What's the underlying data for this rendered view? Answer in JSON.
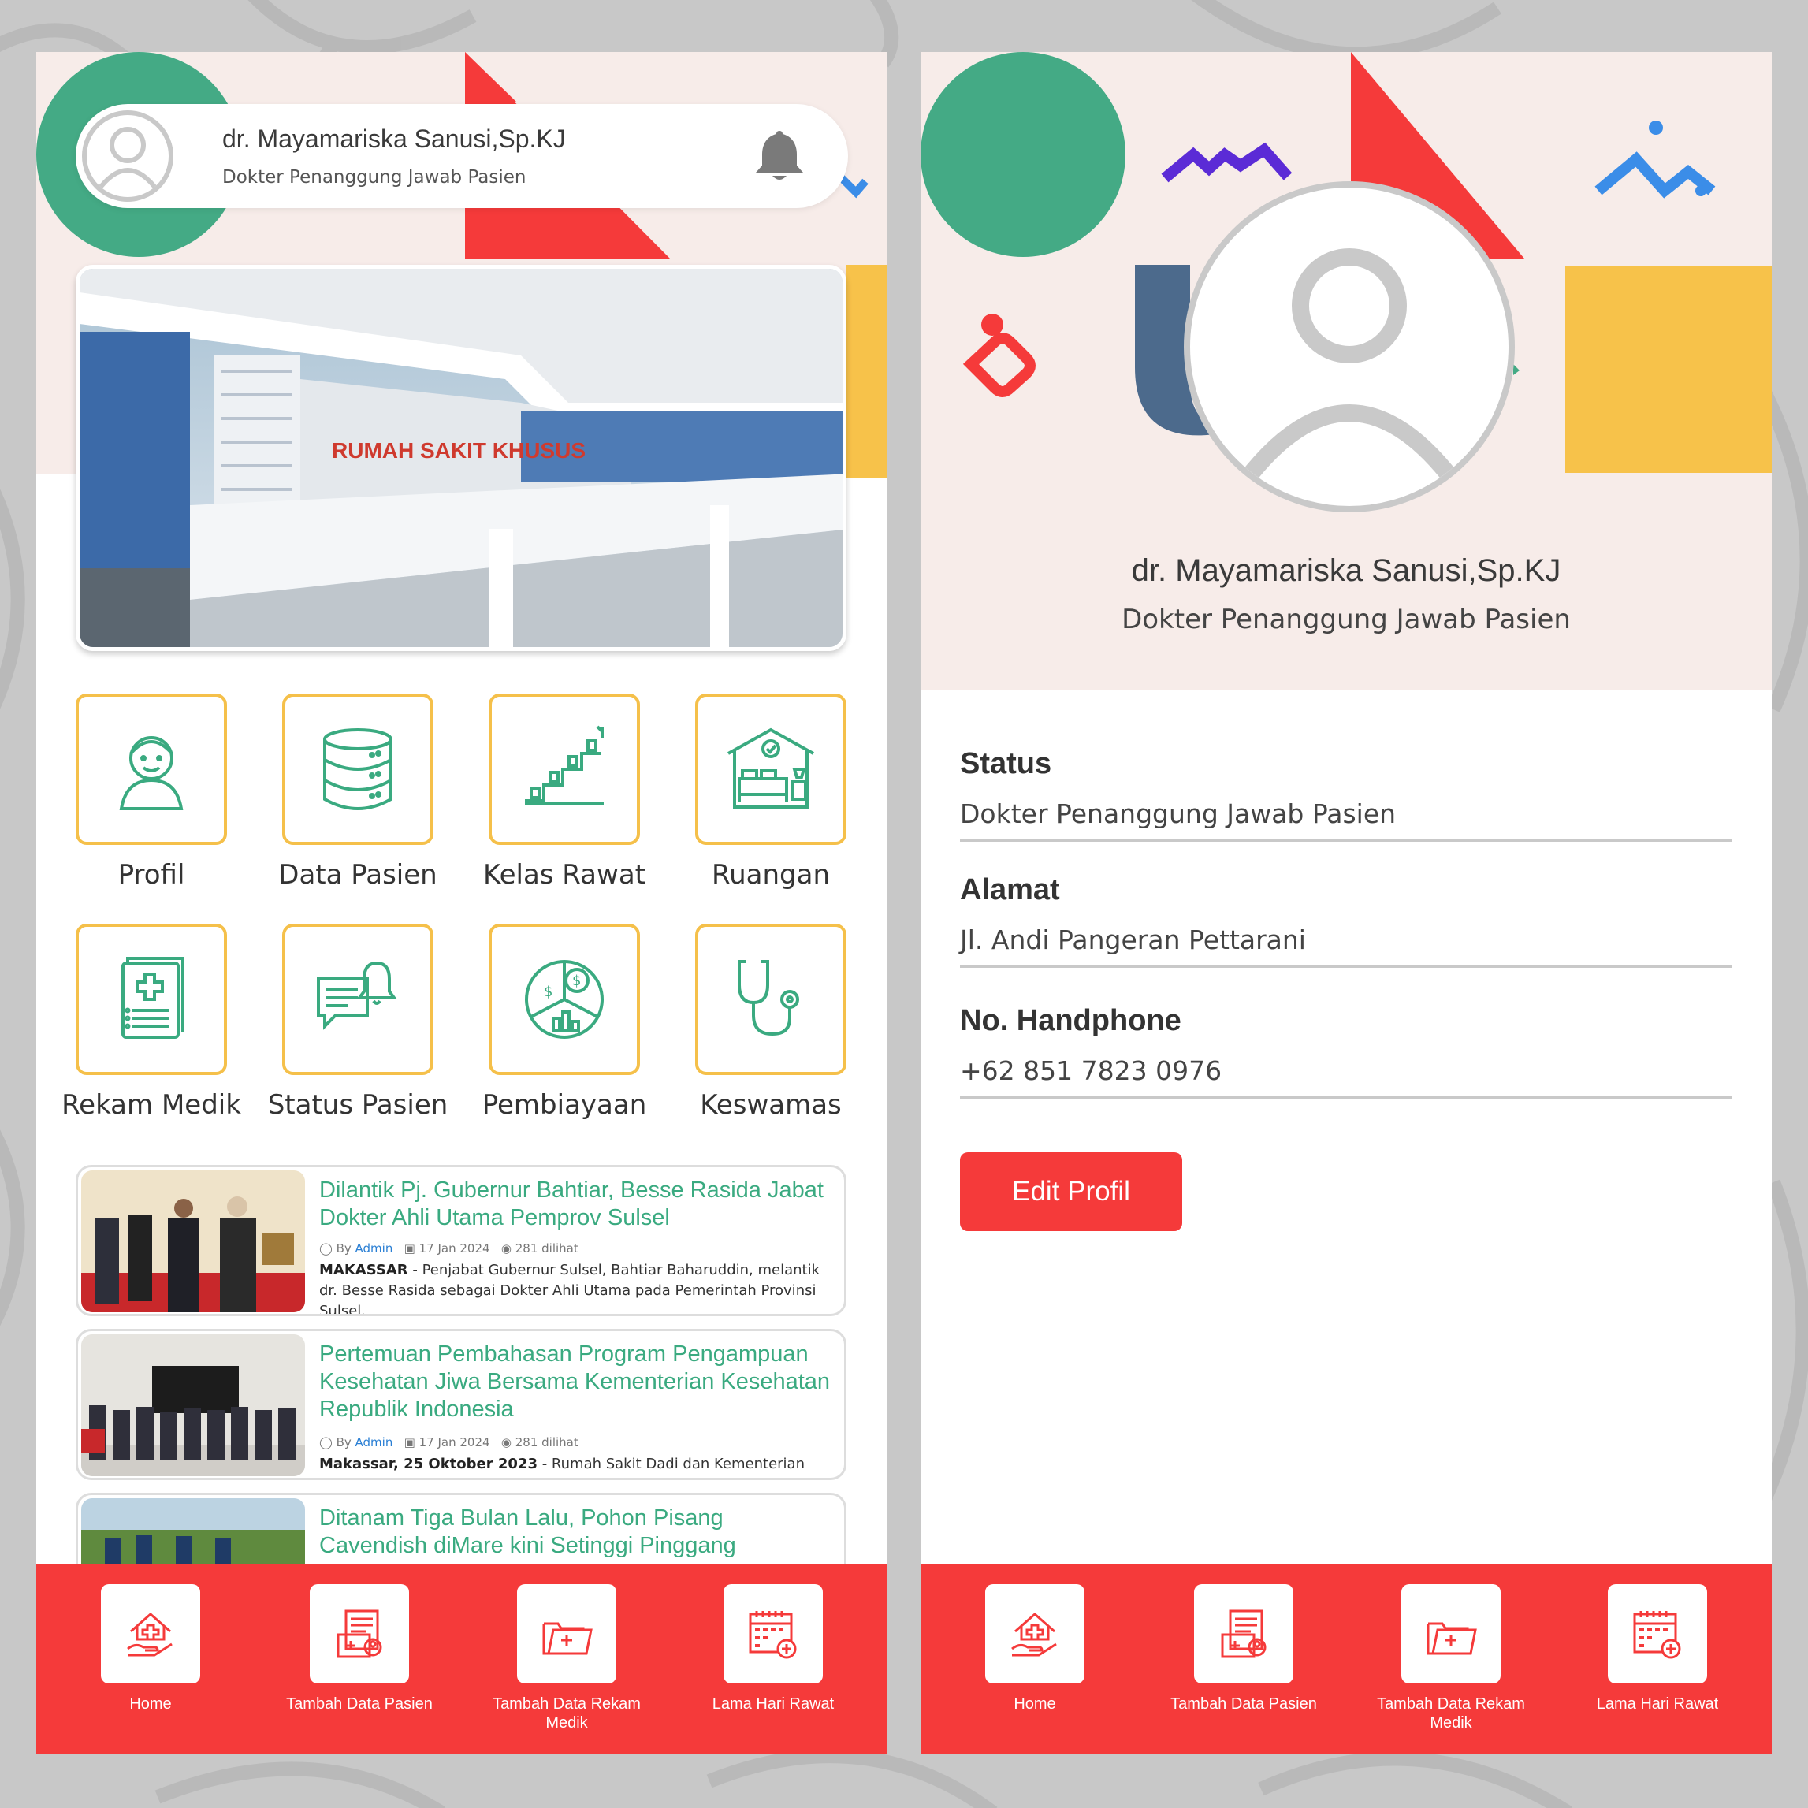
{
  "user": {
    "name": "dr. Mayamariska Sanusi,Sp.KJ",
    "role": "Dokter Penanggung Jawab Pasien"
  },
  "menu": [
    {
      "label": "Profil",
      "icon": "person-icon"
    },
    {
      "label": "Data Pasien",
      "icon": "database-icon"
    },
    {
      "label": "Kelas Rawat",
      "icon": "stairs-growth-icon"
    },
    {
      "label": "Ruangan",
      "icon": "room-bed-icon"
    },
    {
      "label": "Rekam Medik",
      "icon": "medical-record-icon"
    },
    {
      "label": "Status Pasien",
      "icon": "chat-bell-icon"
    },
    {
      "label": "Pembiayaan",
      "icon": "finance-chart-icon"
    },
    {
      "label": "Keswamas",
      "icon": "stethoscope-icon"
    }
  ],
  "news": [
    {
      "title": "Dilantik Pj. Gubernur Bahtiar, Besse Rasida Jabat Dokter Ahli Utama Pemprov Sulsel",
      "by": "By",
      "author": "Admin",
      "date": "17 Jan 2024",
      "views": "281 dilihat",
      "lead": "MAKASSAR",
      "body": " - Penjabat Gubernur Sulsel, Bahtiar Baharuddin, melantik dr. Besse Rasida sebagai Dokter Ahli Utama pada Pemerintah Provinsi Sulsel."
    },
    {
      "title": "Pertemuan Pembahasan Program Pengampuan Kesehatan Jiwa Bersama Kementerian Kesehatan Republik Indonesia",
      "by": "By",
      "author": "Admin",
      "date": "17 Jan 2024",
      "views": "281 dilihat",
      "lead": "Makassar, 25 Oktober 2023",
      "body": " - Rumah Sakit Dadi dan Kementerian"
    },
    {
      "title": "Ditanam Tiga Bulan Lalu, Pohon Pisang Cavendish diMare kini Setinggi Pinggang"
    }
  ],
  "nav": [
    {
      "label": "Home",
      "icon": "home-care-icon"
    },
    {
      "label": "Tambah Data Pasien",
      "icon": "add-patient-icon"
    },
    {
      "label": "Tambah Data Rekam Medik",
      "icon": "add-folder-icon"
    },
    {
      "label": "Lama Hari Rawat",
      "icon": "calendar-add-icon"
    }
  ],
  "profile": {
    "fields": [
      {
        "label": "Status",
        "value": "Dokter Penanggung Jawab Pasien"
      },
      {
        "label": "Alamat",
        "value": "Jl. Andi Pangeran Pettarani"
      },
      {
        "label": "No. Handphone",
        "value": "+62 851 7823 0976"
      }
    ],
    "edit_label": "Edit Profil"
  },
  "colors": {
    "accent_red": "#f53a3a",
    "green": "#3aaa80",
    "yellow_border": "#f5c04a",
    "header_bg": "#f7ece9"
  }
}
